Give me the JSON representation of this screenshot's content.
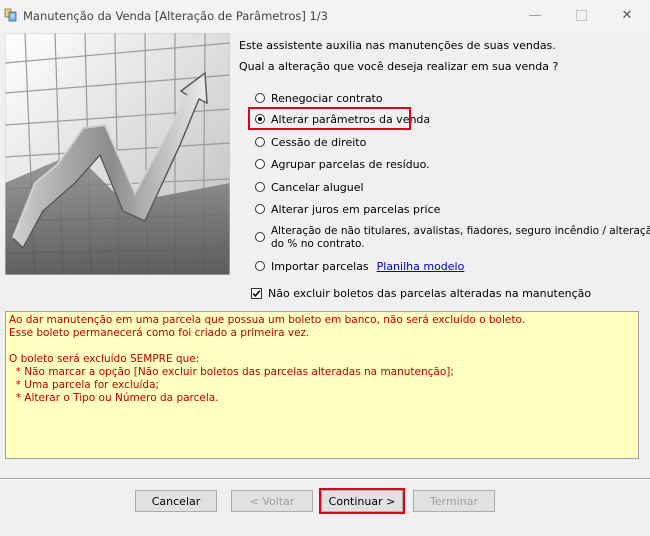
{
  "window": {
    "title": "Manutenção da Venda [Alteração de Parâmetros] 1/3"
  },
  "intro": {
    "line1": "Este assistente auxilia nas manutenções de suas vendas.",
    "line2": "Qual a alteração que você deseja realizar em sua venda ?"
  },
  "options": [
    {
      "label": "Renegociar contrato",
      "selected": false
    },
    {
      "label": "Alterar parâmetros da venda",
      "selected": true
    },
    {
      "label": "Cessão de direito",
      "selected": false
    },
    {
      "label": "Agrupar parcelas de resíduo.",
      "selected": false
    },
    {
      "label": "Cancelar aluguel",
      "selected": false
    },
    {
      "label": "Alterar juros em parcelas price",
      "selected": false
    },
    {
      "label": "Alteração de não titulares, avalistas, fiadores, seguro incêndio / alteração",
      "label_line2": "do % no contrato.",
      "selected": false
    },
    {
      "label": "Importar parcelas",
      "link": "Planilha modelo",
      "selected": false
    }
  ],
  "keep_boletos": {
    "label": "Não excluir boletos das parcelas alteradas na manutenção",
    "checked": true
  },
  "notes": [
    "Ao dar manutenção em uma parcela que possua um boleto em banco, não será excluído o boleto.",
    "Esse boleto permanecerá como foi criado a primeira vez.",
    "",
    "O boleto será excluído SEMPRE que:",
    "  * Não marcar a opção [Não excluir boletos das parcelas alteradas na manutenção];",
    "  * Uma parcela for excluída;",
    "  * Alterar o Tipo ou Número da parcela."
  ],
  "buttons": {
    "cancel": "Cancelar",
    "back": "< Voltar",
    "next": "Continuar >",
    "finish": "Terminar"
  },
  "colors": {
    "highlight": "#e1001a",
    "notes_background": "#ffffc0",
    "notes_text": "#c00000",
    "link": "#0000cc"
  }
}
